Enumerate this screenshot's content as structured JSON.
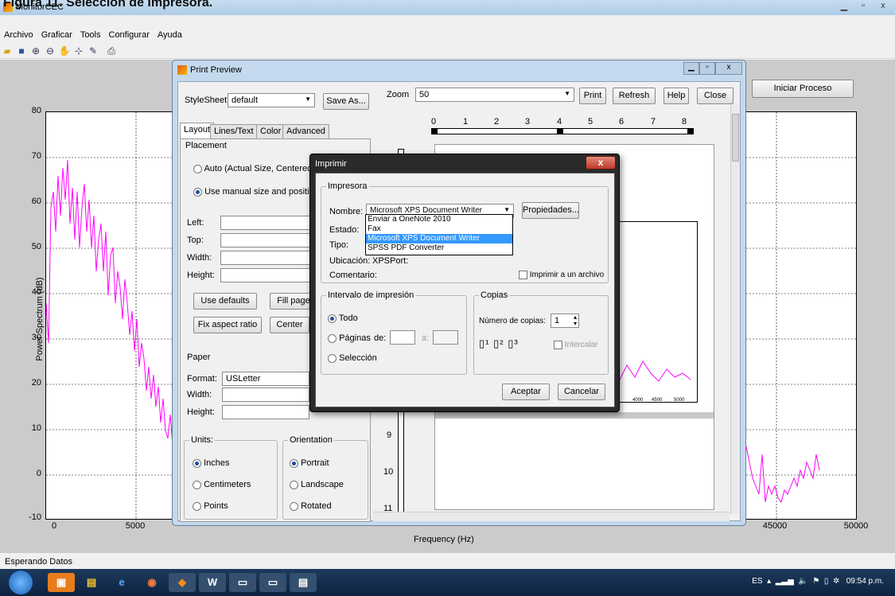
{
  "caption": "Figura  11. Selección de Impresora.",
  "app": {
    "title": "MonitorCEC",
    "menu": [
      "Archivo",
      "Graficar",
      "Tools",
      "Configurar",
      "Ayuda"
    ]
  },
  "plot": {
    "ylabel": "Power Spectrum (dB)",
    "xlabel": "Frequency (Hz)",
    "yticks": [
      "80",
      "70",
      "60",
      "50",
      "40",
      "30",
      "20",
      "10",
      "0",
      "-10"
    ],
    "xticks": [
      "0",
      "5000",
      "45000",
      "50000"
    ],
    "button": "Iniciar Proceso",
    "line_color": "#ff00ff"
  },
  "status": "Esperando Datos",
  "print_preview": {
    "title": "Print Preview",
    "stylesheet_label": "StyleSheet",
    "stylesheet_value": "default",
    "save_as": "Save As...",
    "zoom_label": "Zoom",
    "zoom_value": "50",
    "buttons": [
      "Print",
      "Refresh",
      "Help",
      "Close"
    ],
    "tabs": [
      "Layout",
      "Lines/Text",
      "Color",
      "Advanced"
    ],
    "placement": "Placement",
    "auto": "Auto (Actual Size, Centered)",
    "manual": "Use manual size and position",
    "left": "Left:",
    "top": "Top:",
    "width": "Width:",
    "height": "Height:",
    "use_defaults": "Use defaults",
    "fill_page": "Fill page",
    "fix_aspect": "Fix aspect ratio",
    "center": "Center",
    "paper": "Paper",
    "format": "Format:",
    "format_value": "USLetter",
    "units": "Units:",
    "inches": "Inches",
    "centimeters": "Centimeters",
    "points": "Points",
    "orientation": "Orientation",
    "portrait": "Portrait",
    "landscape": "Landscape",
    "rotated": "Rotated",
    "ruler_h": [
      "0",
      "1",
      "2",
      "3",
      "4",
      "5",
      "6",
      "7",
      "8"
    ],
    "ruler_v": [
      "9",
      "10",
      "11"
    ],
    "mini_ticks": [
      "4000",
      "4500",
      "5000"
    ]
  },
  "imprimir": {
    "title": "Imprimir",
    "impresora": "Impresora",
    "nombre": "Nombre:",
    "nombre_value": "Microsoft XPS Document Writer",
    "propiedades": "Propiedades...",
    "estado": "Estado:",
    "tipo": "Tipo:",
    "ubicacion": "Ubicación:",
    "ubicacion_value": "XPSPort:",
    "comentario": "Comentario:",
    "imprimir_archivo": "Imprimir a un archivo",
    "options": [
      "Enviar a OneNote 2010",
      "Fax",
      "Microsoft XPS Document Writer",
      "SPSS PDF Converter"
    ],
    "intervalo": "Intervalo de impresión",
    "todo": "Todo",
    "paginas": "Páginas",
    "de": "de:",
    "a": "a:",
    "seleccion": "Selección",
    "copias": "Copias",
    "numero_copias": "Número de copias:",
    "copias_value": "1",
    "intercalar": "Intercalar",
    "aceptar": "Aceptar",
    "cancelar": "Cancelar"
  },
  "tray": {
    "lang": "ES",
    "time": "09:54 p.m."
  }
}
